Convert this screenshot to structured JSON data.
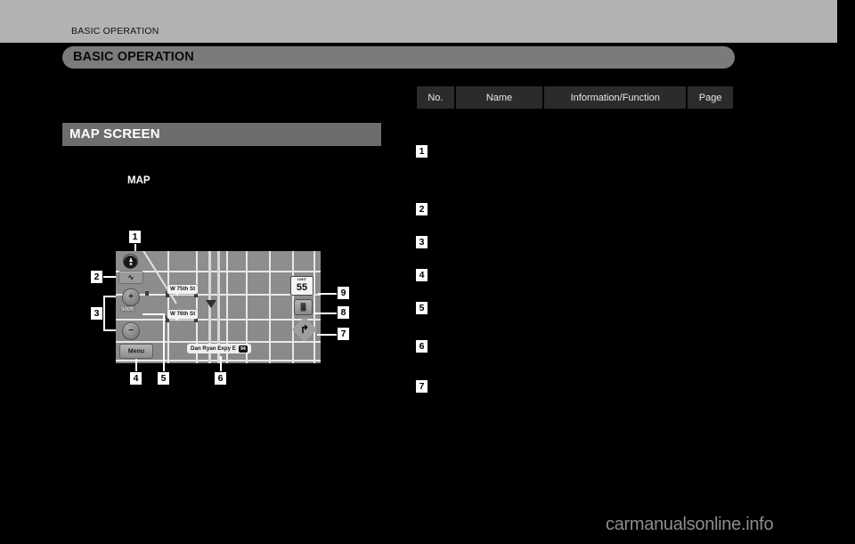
{
  "page": {
    "running_header": "BASIC OPERATION",
    "chapter_banner": "BASIC OPERATION",
    "section_heading": "MAP SCREEN",
    "body_label": "MAP",
    "watermark": "carmanualsonline.info"
  },
  "table": {
    "columns": [
      {
        "key": "no",
        "label": "No."
      },
      {
        "key": "name",
        "label": "Name"
      },
      {
        "key": "info",
        "label": "Information/Function"
      },
      {
        "key": "page",
        "label": "Page"
      }
    ],
    "rows": [
      {
        "no": "1",
        "name": "",
        "info": "",
        "page": ""
      },
      {
        "no": "2",
        "name": "",
        "info": "",
        "page": ""
      },
      {
        "no": "3",
        "name": "",
        "info": "",
        "page": ""
      },
      {
        "no": "4",
        "name": "",
        "info": "",
        "page": ""
      },
      {
        "no": "5",
        "name": "",
        "info": "",
        "page": ""
      },
      {
        "no": "6",
        "name": "",
        "info": "",
        "page": ""
      },
      {
        "no": "7",
        "name": "",
        "info": "",
        "page": ""
      }
    ]
  },
  "figure": {
    "callouts": [
      "1",
      "2",
      "3",
      "4",
      "5",
      "6",
      "7",
      "8",
      "9"
    ],
    "map_screen": {
      "street_labels": [
        {
          "id": "w75",
          "text": "W 75th St"
        },
        {
          "id": "w76",
          "text": "W 76th St"
        }
      ],
      "expressway_label": {
        "text": "Dan Ryan Expy E",
        "shield": "94"
      },
      "scale": "500ft",
      "menu_button": "Menu",
      "speed_limit": {
        "title": "LIMIT",
        "value": "55"
      },
      "compass_icon": "compass-icon",
      "route_overview_icon": "route-overview-icon",
      "zoom_in_icon": "+",
      "zoom_out_icon": "−",
      "traffic_icon": "▓",
      "turn_arrow_icon": "↱"
    }
  },
  "colors": {
    "band_gray": "#b2b2b2",
    "banner_gray": "#7b7b7b",
    "section_gray": "#6d6d6d",
    "table_header_gray": "#2b2b2b",
    "page_black": "#000000",
    "watermark_gray": "#8c8c8c"
  }
}
